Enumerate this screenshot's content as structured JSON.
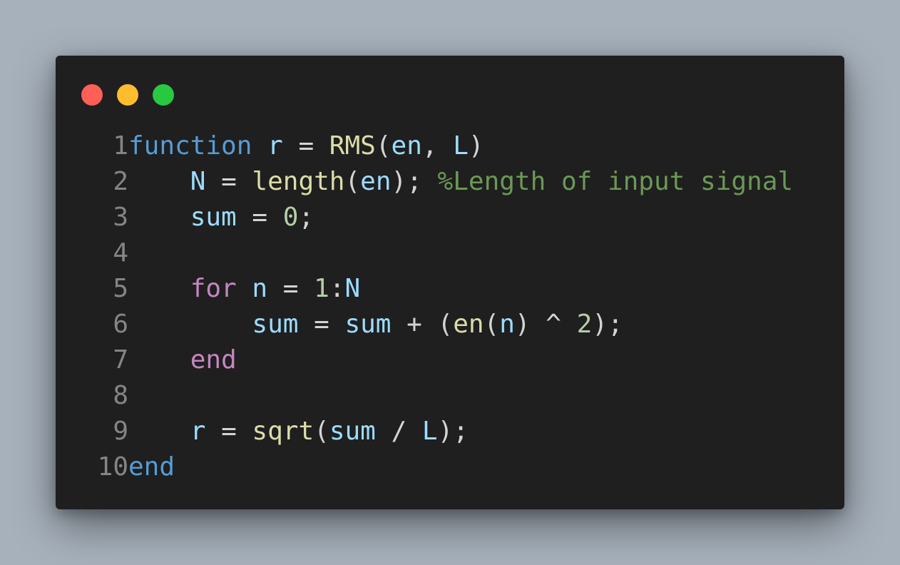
{
  "window": {
    "traffic_lights": [
      {
        "name": "close",
        "color": "#ff5f57"
      },
      {
        "name": "minimize",
        "color": "#febc2e"
      },
      {
        "name": "maximize",
        "color": "#28c840"
      }
    ],
    "line_number_color": "#858585"
  },
  "lines": [
    {
      "number": "1",
      "tokens": [
        {
          "text": "function",
          "color": "#569cd6"
        },
        {
          "text": " ",
          "color": "#d4d4d4"
        },
        {
          "text": "r",
          "color": "#9cdcfe"
        },
        {
          "text": " = ",
          "color": "#d4d4d4"
        },
        {
          "text": "RMS",
          "color": "#dcdcaa"
        },
        {
          "text": "(",
          "color": "#d4d4d4"
        },
        {
          "text": "en",
          "color": "#9cdcfe"
        },
        {
          "text": ", ",
          "color": "#d4d4d4"
        },
        {
          "text": "L",
          "color": "#9cdcfe"
        },
        {
          "text": ")",
          "color": "#d4d4d4"
        }
      ]
    },
    {
      "number": "2",
      "tokens": [
        {
          "text": "    ",
          "color": "#d4d4d4"
        },
        {
          "text": "N",
          "color": "#9cdcfe"
        },
        {
          "text": " = ",
          "color": "#d4d4d4"
        },
        {
          "text": "length",
          "color": "#dcdcaa"
        },
        {
          "text": "(",
          "color": "#d4d4d4"
        },
        {
          "text": "en",
          "color": "#9cdcfe"
        },
        {
          "text": "); ",
          "color": "#d4d4d4"
        },
        {
          "text": "%Length of input signal",
          "color": "#6a9955"
        }
      ]
    },
    {
      "number": "3",
      "tokens": [
        {
          "text": "    ",
          "color": "#d4d4d4"
        },
        {
          "text": "sum",
          "color": "#9cdcfe"
        },
        {
          "text": " = ",
          "color": "#d4d4d4"
        },
        {
          "text": "0",
          "color": "#b5cea8"
        },
        {
          "text": ";",
          "color": "#d4d4d4"
        }
      ]
    },
    {
      "number": "4",
      "tokens": []
    },
    {
      "number": "5",
      "tokens": [
        {
          "text": "    ",
          "color": "#d4d4d4"
        },
        {
          "text": "for",
          "color": "#c586c0"
        },
        {
          "text": " ",
          "color": "#d4d4d4"
        },
        {
          "text": "n",
          "color": "#9cdcfe"
        },
        {
          "text": " = ",
          "color": "#d4d4d4"
        },
        {
          "text": "1",
          "color": "#b5cea8"
        },
        {
          "text": ":",
          "color": "#d4d4d4"
        },
        {
          "text": "N",
          "color": "#9cdcfe"
        }
      ]
    },
    {
      "number": "6",
      "tokens": [
        {
          "text": "        ",
          "color": "#d4d4d4"
        },
        {
          "text": "sum",
          "color": "#9cdcfe"
        },
        {
          "text": " = ",
          "color": "#d4d4d4"
        },
        {
          "text": "sum",
          "color": "#9cdcfe"
        },
        {
          "text": " + (",
          "color": "#d4d4d4"
        },
        {
          "text": "en",
          "color": "#dcdcaa"
        },
        {
          "text": "(",
          "color": "#d4d4d4"
        },
        {
          "text": "n",
          "color": "#9cdcfe"
        },
        {
          "text": ") ^ ",
          "color": "#d4d4d4"
        },
        {
          "text": "2",
          "color": "#b5cea8"
        },
        {
          "text": ");",
          "color": "#d4d4d4"
        }
      ]
    },
    {
      "number": "7",
      "tokens": [
        {
          "text": "    ",
          "color": "#d4d4d4"
        },
        {
          "text": "end",
          "color": "#c586c0"
        }
      ]
    },
    {
      "number": "8",
      "tokens": []
    },
    {
      "number": "9",
      "tokens": [
        {
          "text": "    ",
          "color": "#d4d4d4"
        },
        {
          "text": "r",
          "color": "#9cdcfe"
        },
        {
          "text": " = ",
          "color": "#d4d4d4"
        },
        {
          "text": "sqrt",
          "color": "#dcdcaa"
        },
        {
          "text": "(",
          "color": "#d4d4d4"
        },
        {
          "text": "sum",
          "color": "#9cdcfe"
        },
        {
          "text": " / ",
          "color": "#d4d4d4"
        },
        {
          "text": "L",
          "color": "#9cdcfe"
        },
        {
          "text": ");",
          "color": "#d4d4d4"
        }
      ]
    },
    {
      "number": "10",
      "tokens": [
        {
          "text": "end",
          "color": "#569cd6"
        }
      ]
    }
  ]
}
